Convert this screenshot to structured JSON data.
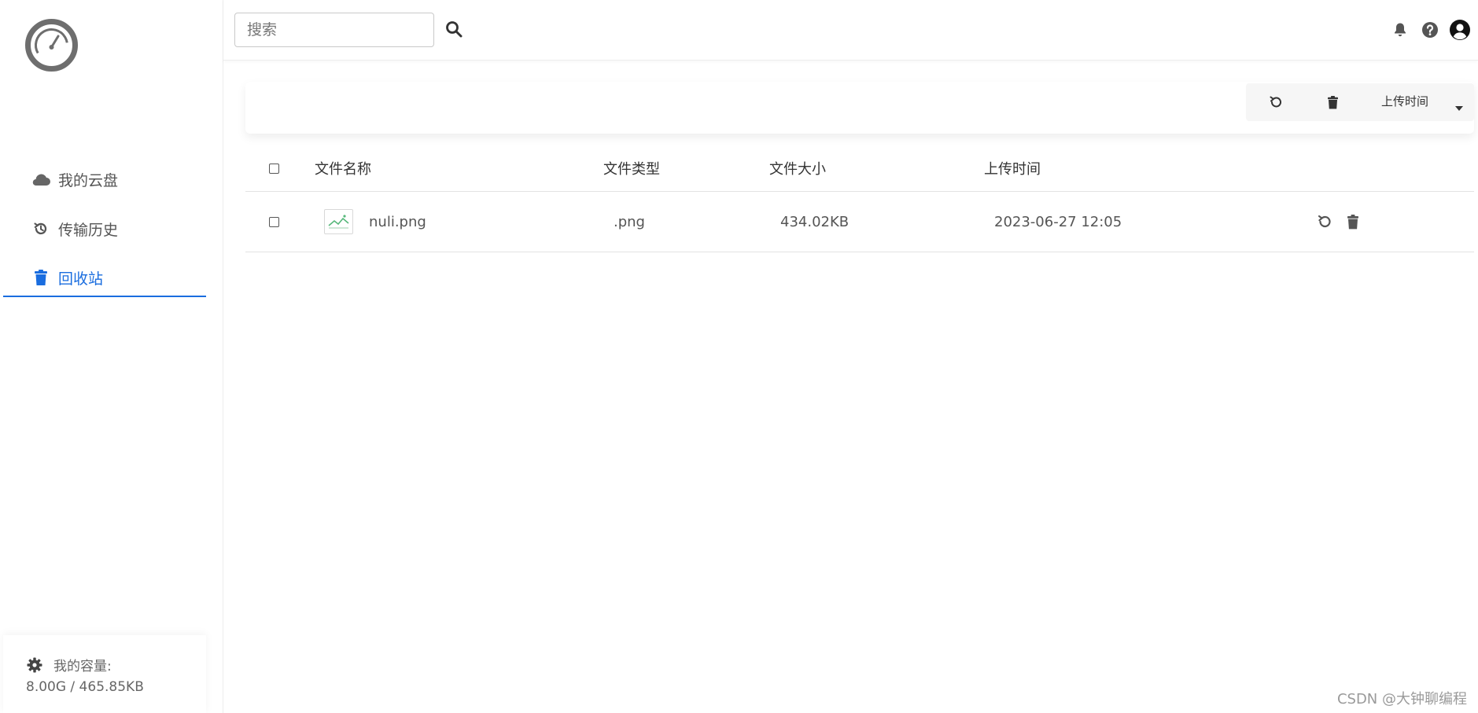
{
  "sidebar": {
    "logo_icon": "speedometer-icon",
    "nav": [
      {
        "label": "我的云盘",
        "icon": "cloud-icon",
        "active": false
      },
      {
        "label": "传输历史",
        "icon": "history-icon",
        "active": false
      },
      {
        "label": "回收站",
        "icon": "trash-icon",
        "active": true
      }
    ],
    "capacity": {
      "label": "我的容量:",
      "value": "8.00G / 465.85KB",
      "icon": "gear-icon"
    }
  },
  "topbar": {
    "search": {
      "placeholder": "搜索",
      "value": ""
    },
    "icons": [
      "search-icon",
      "bell-icon",
      "help-icon",
      "user-icon"
    ]
  },
  "toolbar": {
    "actions": [
      "restore-icon",
      "trash-icon"
    ],
    "sort_label": "上传时间",
    "sort_icon": "caret-down-icon"
  },
  "table": {
    "columns": [
      "文件名称",
      "文件类型",
      "文件大小",
      "上传时间"
    ],
    "rows": [
      {
        "name": "nuli.png",
        "type": ".png",
        "size": "434.02KB",
        "uploaded": "2023-06-27 12:05",
        "thumb_icon": "image-icon",
        "actions": [
          "restore-icon",
          "trash-icon"
        ]
      }
    ]
  },
  "watermark": "CSDN @大钟聊编程",
  "colors": {
    "accent": "#1a6ddf",
    "text": "#333333",
    "muted": "#666666",
    "border": "#e3e3e3"
  }
}
